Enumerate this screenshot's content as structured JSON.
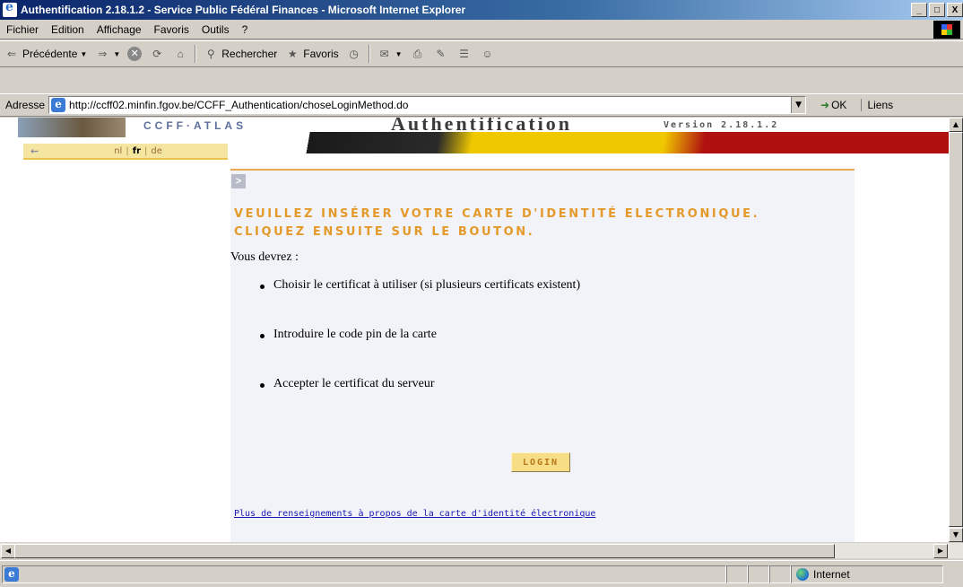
{
  "window": {
    "title": "Authentification 2.18.1.2 - Service Public Fédéral Finances - Microsoft Internet Explorer",
    "min_label": "_",
    "max_label": "□",
    "close_label": "X"
  },
  "menu": {
    "items": [
      {
        "label": "Fichier"
      },
      {
        "label": "Edition"
      },
      {
        "label": "Affichage"
      },
      {
        "label": "Favoris"
      },
      {
        "label": "Outils"
      },
      {
        "label": "?"
      }
    ]
  },
  "toolbar": {
    "back_label": "Précédente",
    "search_label": "Rechercher",
    "favorites_label": "Favoris"
  },
  "address": {
    "label": "Adresse",
    "url": "http://ccff02.minfin.fgov.be/CCFF_Authentication/choseLoginMethod.do",
    "go_label": "OK",
    "links_label": "Liens"
  },
  "page": {
    "banner": {
      "logo_text": "CCFF·ATLAS",
      "title": "Authentification",
      "version": "Version 2.18.1.2"
    },
    "languages": {
      "nl": "nl",
      "fr": "fr",
      "de": "de",
      "sep": "|"
    },
    "headline_line1": "VEUILLEZ INSÉRER VOTRE CARTE D'IDENTITÉ ELECTRONIQUE.",
    "headline_line2": "CLIQUEZ ENSUITE SUR LE BOUTON.",
    "intro": "Vous devrez :",
    "steps": [
      {
        "text": "Choisir le certificat à utiliser (si plusieurs certificats existent)"
      },
      {
        "text": "Introduire le code pin de la carte"
      },
      {
        "text": "Accepter le certificat du serveur"
      }
    ],
    "login_label": "LOGIN",
    "info_link": "Plus de renseignements à propos de la carte d'identité électronique"
  },
  "status": {
    "zone": "Internet"
  },
  "colors": {
    "accent": "#e49a2a",
    "panel_bg": "#f1f3f9",
    "lang_bar": "#f4e5a1",
    "login_bg": "#f6dd86"
  }
}
